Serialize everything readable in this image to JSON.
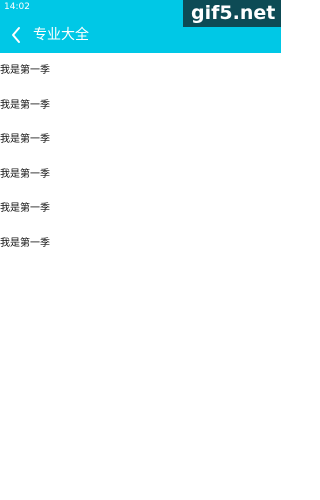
{
  "status_bar": {
    "time": "14:02",
    "icons": "▼ ▲ ▮"
  },
  "app_bar": {
    "title": "专业大全",
    "back_icon": "chevron-left-icon"
  },
  "watermark": {
    "text": "gif5.net"
  },
  "list": {
    "items": [
      {
        "label": "我是第一季"
      },
      {
        "label": "我是第一季"
      },
      {
        "label": "我是第一季"
      },
      {
        "label": "我是第一季"
      },
      {
        "label": "我是第一季"
      },
      {
        "label": "我是第一季"
      }
    ]
  },
  "colors": {
    "app_bar": "#00c8e6",
    "watermark_bg": "#0d4b55",
    "text": "#111111",
    "background": "#ffffff"
  }
}
